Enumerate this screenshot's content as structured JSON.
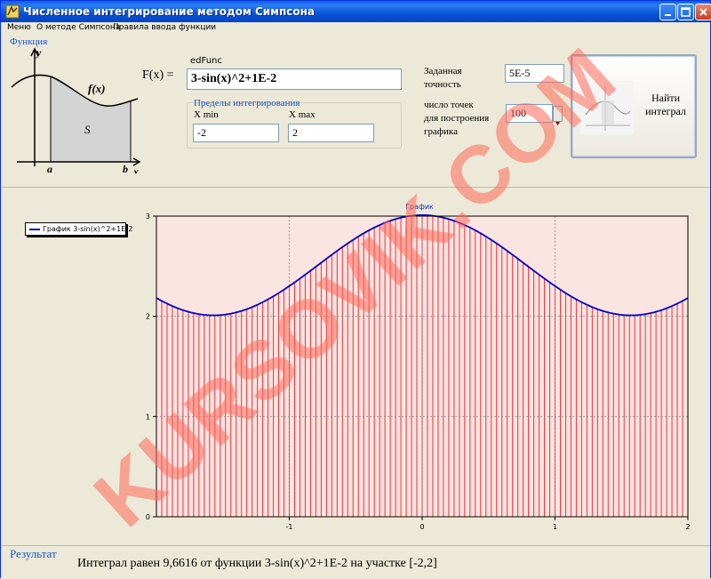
{
  "window": {
    "title": "Численное интегрирование методом Симпсона"
  },
  "menu": [
    "Меню",
    "О методе Симпсона",
    "Правила ввода функции"
  ],
  "function_group": {
    "label": "Функция",
    "figure": {
      "fx": "f(x)",
      "area": "S",
      "a": "a",
      "b": "b",
      "x": "x",
      "y": "y"
    },
    "fx_label": "F(x) =",
    "edit_label": "edFunc",
    "edit_value": "3-sin(x)^2+1E-2"
  },
  "limits": {
    "label": "Пределы интегрирования",
    "xmin_label": "X min",
    "xmin_value": "-2",
    "xmax_label": "X max",
    "xmax_value": "2"
  },
  "precision": {
    "label_line1": "Заданная",
    "label_line2": "точность",
    "value": "5E-5"
  },
  "points": {
    "label_line1": "число точек",
    "label_line2": "для построения",
    "label_line3": "графика",
    "value": "100"
  },
  "calc_button": {
    "line1": "Найти",
    "line2": "интеграл"
  },
  "chart_data": {
    "type": "line",
    "title": "График",
    "legend": "График 3-sin(x)^2+1E-2",
    "legend_position": "top-left",
    "function": "3-sin(x)^2+1E-2",
    "xlim": [
      -2,
      2
    ],
    "ylim": [
      0,
      3
    ],
    "x_ticks": [
      "-1",
      "0",
      "1",
      "2"
    ],
    "y_ticks": [
      "0",
      "1",
      "2",
      "3"
    ],
    "grid": true,
    "fill_lines": 100,
    "colors": {
      "line": "#0000cc",
      "fill": "#e8323c",
      "fill_bg": "#fce4e0"
    }
  },
  "result": {
    "label": "Результат",
    "text": "Интеграл равен 9,6616 от функции 3-sin(x)^2+1E-2 на участке [-2,2]"
  },
  "watermark": "KURSOVIK.COM"
}
